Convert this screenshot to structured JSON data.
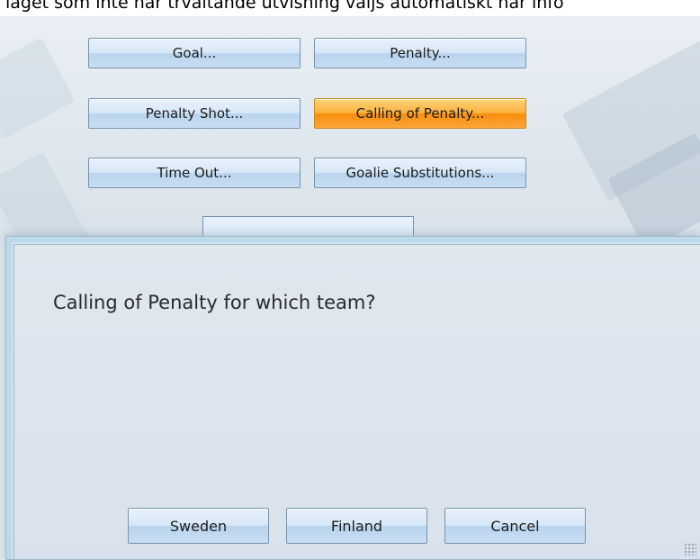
{
  "background_text": "laget som inte har trvaltande utvisning valjs automatiskt har info",
  "actions": {
    "goal": "Goal...",
    "penalty": "Penalty...",
    "penalty_shot": "Penalty Shot...",
    "calling_of_penalty": "Calling of Penalty...",
    "time_out": "Time Out...",
    "goalie_substitutions": "Goalie Substitutions..."
  },
  "dialog": {
    "question": "Calling of Penalty for which team?",
    "buttons": {
      "sweden": "Sweden",
      "finland": "Finland",
      "cancel": "Cancel"
    }
  },
  "colors": {
    "active_button": "#fbb23e",
    "button_default": "#d8e8f7",
    "dialog_background": "#dfe7ef"
  }
}
